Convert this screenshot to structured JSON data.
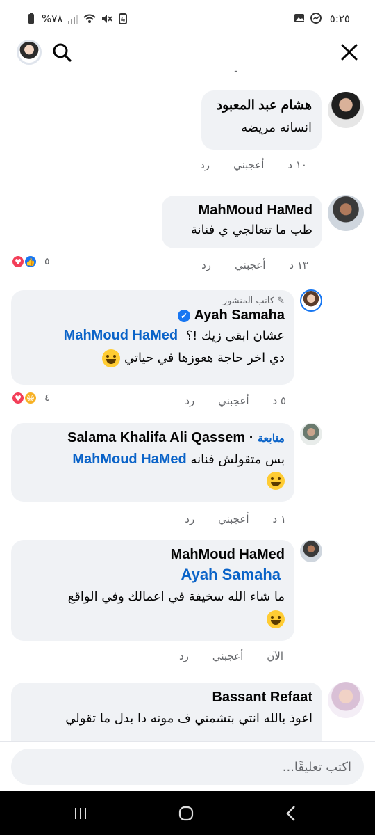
{
  "status_bar": {
    "time": "٥:٢٥",
    "battery": "%٧٨",
    "icons": [
      "messenger-icon",
      "gallery-icon",
      "mute-icon",
      "wifi-icon",
      "signal-icon",
      "battery-icon"
    ]
  },
  "header": {
    "icons": [
      "close-icon",
      "search-icon"
    ]
  },
  "cut_text": "ـ",
  "comments": [
    {
      "name": "هشام عبد المعبود",
      "text": "انسانه مريضه",
      "time": "١٠ د",
      "like": "أعجبني",
      "reply": "رد"
    },
    {
      "name": "MahMoud HaMed",
      "text": "طب ما تتعالجي ي فنانة",
      "time": "١٣ د",
      "like": "أعجبني",
      "reply": "رد",
      "reaction_count": "٥"
    },
    {
      "author_tag": "كاتب المنشور",
      "name": "Ayah Samaha",
      "mention": "MahMoud HaMed",
      "text_line1": "عشان ابقى زيك !؟",
      "text_line2": "دي اخر حاجة هعوزها في حياتي",
      "time": "٥ د",
      "like": "أعجبني",
      "reply": "رد",
      "reaction_count": "٤"
    },
    {
      "name": "Salama Khalifa Ali Qassem",
      "follow": "متابعة",
      "mention": "MahMoud HaMed",
      "text": "بس متقولش فنانه",
      "time": "١ د",
      "like": "أعجبني",
      "reply": "رد"
    },
    {
      "name": "MahMoud HaMed",
      "mention": "Ayah Samaha",
      "text": "ما شاء الله سخيفة في اعمالك وفي الواقع",
      "time": "الآن",
      "like": "أعجبني",
      "reply": "رد"
    },
    {
      "name": "Bassant Refaat",
      "text": "اعوذ بالله انتي بتشمتي ف موته دا بدل ما تقولي"
    }
  ],
  "input": {
    "placeholder": "اكتب تعليقًا..."
  },
  "navbar": {
    "icons": [
      "recent-apps-icon",
      "home-icon",
      "back-icon"
    ]
  }
}
